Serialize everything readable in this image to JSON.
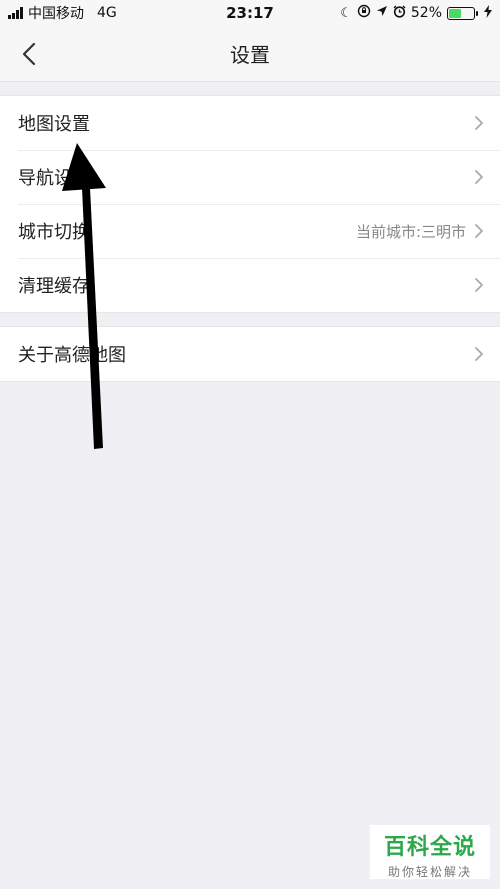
{
  "status_bar": {
    "carrier": "中国移动",
    "network": "4G",
    "time": "23:17",
    "battery_percent": "52%",
    "battery_level": 0.52,
    "icons": [
      "signal-icon",
      "moon-icon",
      "rotation-lock-icon",
      "location-icon",
      "alarm-icon",
      "battery-icon",
      "charging-icon"
    ]
  },
  "nav": {
    "title": "设置",
    "back_icon": "chevron-left-icon"
  },
  "settings": {
    "groups": [
      {
        "items": [
          {
            "label": "地图设置",
            "detail": ""
          },
          {
            "label": "导航设置",
            "detail": ""
          },
          {
            "label": "城市切换",
            "detail": "当前城市:三明市"
          },
          {
            "label": "清理缓存",
            "detail": ""
          }
        ]
      },
      {
        "items": [
          {
            "label": "关于高德地图",
            "detail": ""
          }
        ]
      }
    ]
  },
  "watermark": {
    "main": "百科全说",
    "sub": "助你轻松解决"
  },
  "colors": {
    "background": "#efeff4",
    "battery": "#4cd964",
    "watermark": "#2aa84a"
  }
}
